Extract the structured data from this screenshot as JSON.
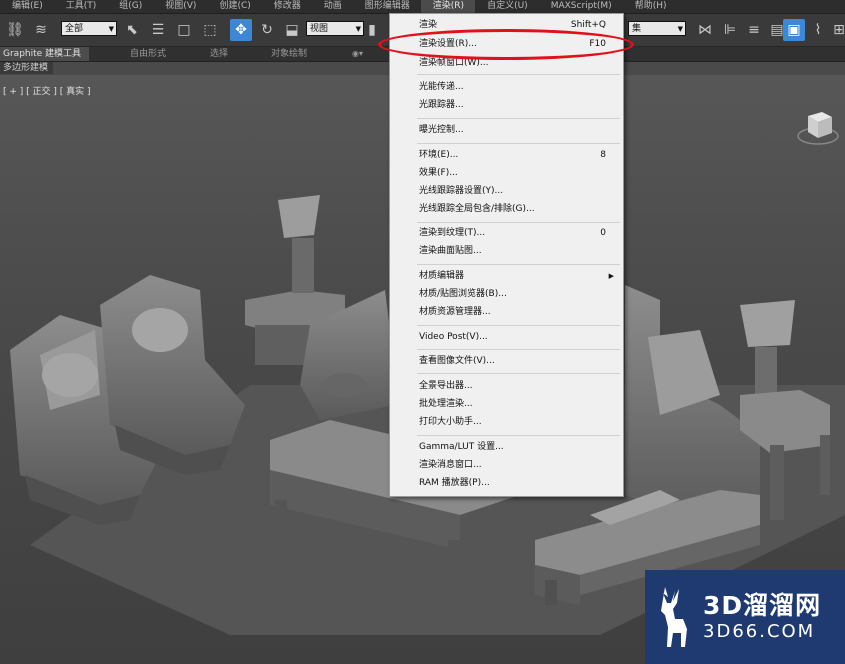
{
  "menubar": [
    "编辑(E)",
    "工具(T)",
    "组(G)",
    "视图(V)",
    "创建(C)",
    "修改器",
    "动画",
    "图形编辑器",
    "渲染(R)",
    "自定义(U)",
    "MAXScript(M)",
    "帮助(H)"
  ],
  "toolbar": {
    "selection_filter": "全部",
    "ref_coord": "视图",
    "named_set": "集"
  },
  "ribbon": {
    "tabs": [
      "Graphite 建模工具",
      "自由形式",
      "选择",
      "对象绘制"
    ],
    "sublabel": "多边形建模"
  },
  "viewport": {
    "label": "[ + ] [ 正交 ] [ 真实 ]"
  },
  "render_menu": {
    "items": [
      {
        "label": "渲染",
        "shortcut": "Shift+Q"
      },
      {
        "label": "渲染设置(R)...",
        "shortcut": "F10"
      },
      {
        "label": "渲染帧窗口(W)...",
        "shortcut": ""
      },
      {
        "label": "光能传递...",
        "shortcut": ""
      },
      {
        "label": "光跟踪器...",
        "shortcut": ""
      },
      {
        "label": "曝光控制...",
        "shortcut": ""
      },
      {
        "label": "环境(E)...",
        "shortcut": "8"
      },
      {
        "label": "效果(F)...",
        "shortcut": ""
      },
      {
        "label": "光线跟踪器设置(Y)...",
        "shortcut": ""
      },
      {
        "label": "光线跟踪全局包含/排除(G)...",
        "shortcut": ""
      },
      {
        "label": "渲染到纹理(T)...",
        "shortcut": "0"
      },
      {
        "label": "渲染曲面贴图...",
        "shortcut": ""
      },
      {
        "label": "材质编辑器",
        "shortcut": ""
      },
      {
        "label": "材质/贴图浏览器(B)...",
        "shortcut": ""
      },
      {
        "label": "材质资源管理器...",
        "shortcut": ""
      },
      {
        "label": "Video Post(V)...",
        "shortcut": ""
      },
      {
        "label": "查看图像文件(V)...",
        "shortcut": ""
      },
      {
        "label": "全景导出器...",
        "shortcut": ""
      },
      {
        "label": "批处理渲染...",
        "shortcut": ""
      },
      {
        "label": "打印大小助手...",
        "shortcut": ""
      },
      {
        "label": "Gamma/LUT 设置...",
        "shortcut": ""
      },
      {
        "label": "渲染消息窗口...",
        "shortcut": ""
      },
      {
        "label": "RAM 播放器(P)...",
        "shortcut": ""
      }
    ]
  },
  "watermark": {
    "title": "3D溜溜网",
    "url": "3D66.COM"
  },
  "colors": {
    "highlight_ring": "#e0111a",
    "active_tool": "#3d87d6",
    "watermark_bg": "#1e3a70"
  }
}
